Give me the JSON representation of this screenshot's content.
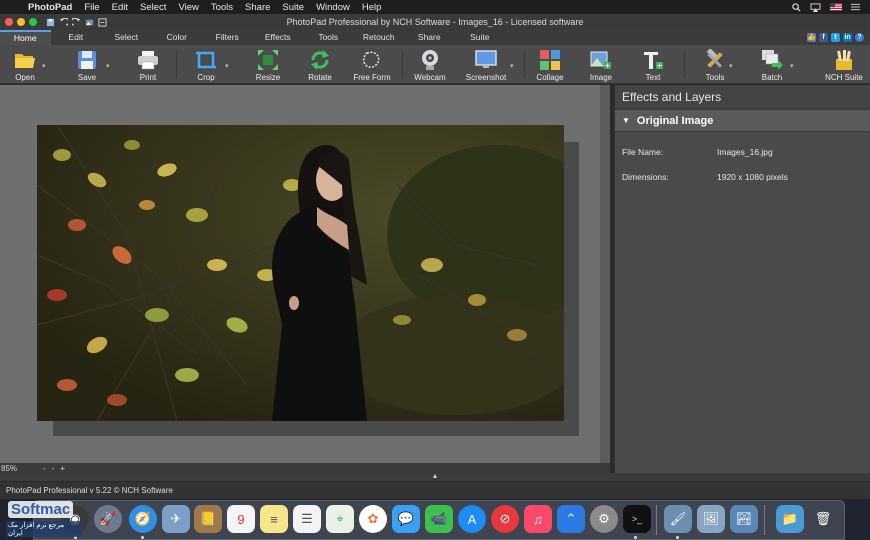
{
  "menubar": {
    "app_name": "PhotoPad",
    "items": [
      "File",
      "Edit",
      "Select",
      "View",
      "Tools",
      "Share",
      "Suite",
      "Window",
      "Help"
    ]
  },
  "window": {
    "title": "PhotoPad Professional by NCH Software - Images_16 - Licensed software"
  },
  "tabs": [
    "Home",
    "Edit",
    "Select",
    "Color",
    "Filters",
    "Effects",
    "Tools",
    "Retouch",
    "Share",
    "Suite"
  ],
  "active_tab": "Home",
  "toolbar": {
    "open": "Open",
    "save": "Save",
    "print": "Print",
    "crop": "Crop",
    "resize": "Resize",
    "rotate": "Rotate",
    "free_form": "Free Form",
    "webcam": "Webcam",
    "screenshot": "Screenshot",
    "collage": "Collage",
    "image": "Image",
    "text": "Text",
    "tools": "Tools",
    "batch": "Batch",
    "nch_suite": "NCH Suite"
  },
  "canvas": {
    "zoom": "85%",
    "zoom_out": "-",
    "zoom_sep": "-",
    "zoom_in": "+"
  },
  "panel": {
    "title": "Effects and Layers",
    "section": "Original Image",
    "props": [
      {
        "key": "File Name:",
        "value": "Images_16.jpg"
      },
      {
        "key": "Dimensions:",
        "value": "1920 x 1080 pixels"
      }
    ]
  },
  "statusbar": {
    "text": "PhotoPad Professional v 5.22 © NCH Software"
  },
  "watermark": {
    "brand": "Softmac",
    "tagline": "مرجع نرم افزار مک ایران"
  },
  "colors": {
    "accent": "#5aa0e8",
    "menubar": "#1e1e1e",
    "toolbar": "#4b4b4b",
    "panel": "#4a4a4a",
    "canvas": "#6f6f6f"
  }
}
